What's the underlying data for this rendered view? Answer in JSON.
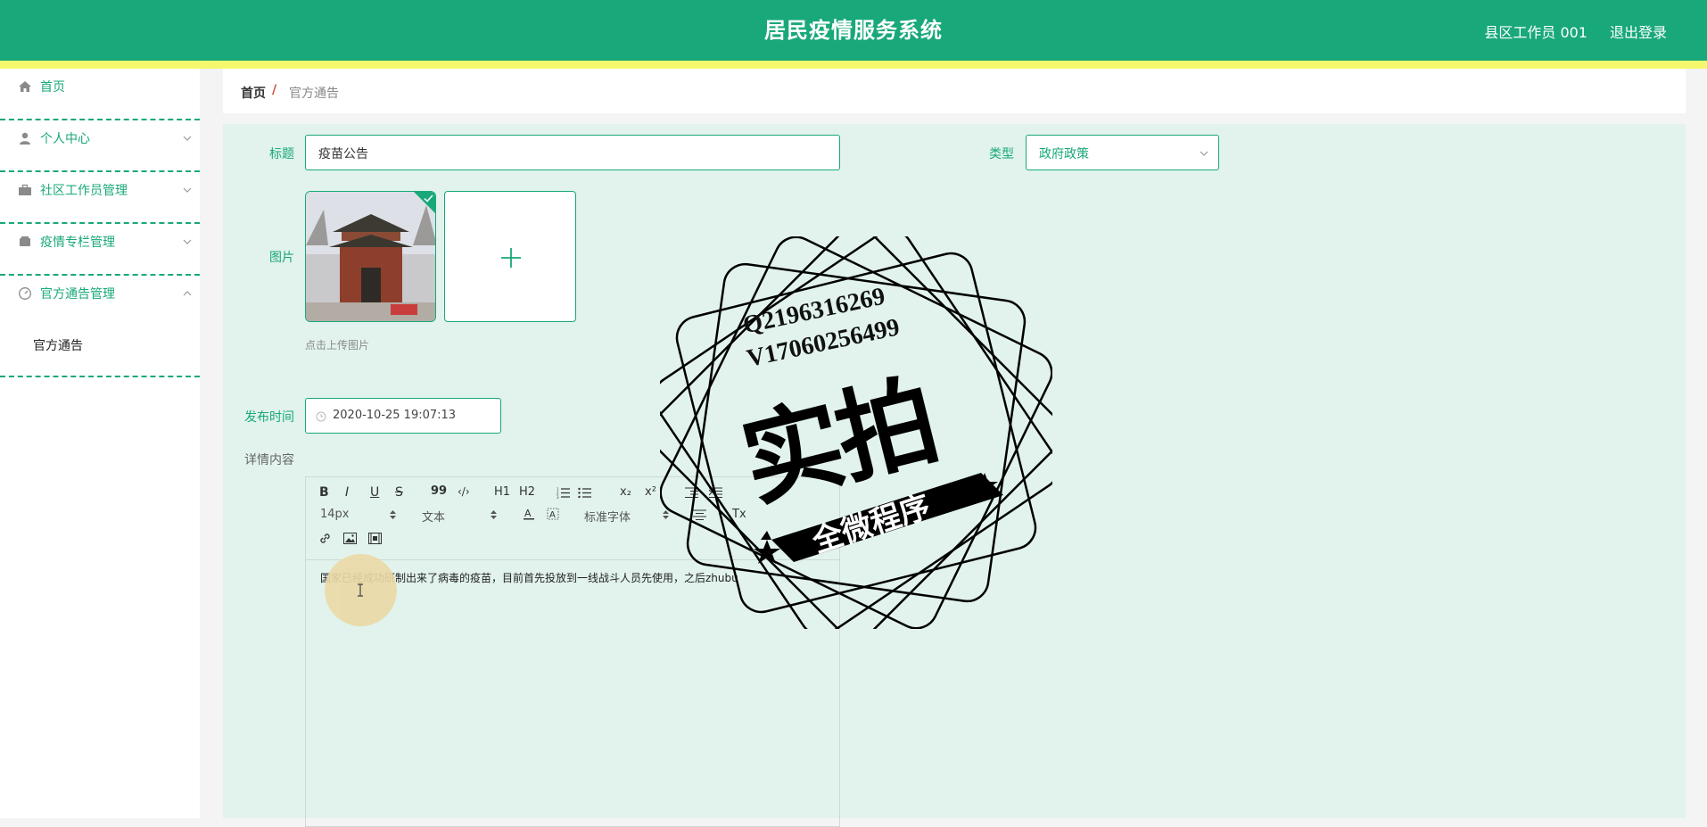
{
  "header": {
    "title": "居民疫情服务系统",
    "user": "县区工作员 001",
    "logout": "退出登录"
  },
  "sidebar": {
    "items": [
      {
        "label": "首页",
        "icon": "home-icon",
        "expandable": false
      },
      {
        "label": "个人中心",
        "icon": "user-icon",
        "expandable": true
      },
      {
        "label": "社区工作员管理",
        "icon": "briefcase-icon",
        "expandable": true
      },
      {
        "label": "疫情专栏管理",
        "icon": "folder-icon",
        "expandable": true
      },
      {
        "label": "官方通告管理",
        "icon": "dashboard-icon",
        "expandable": true,
        "expanded": true
      }
    ],
    "submenu": {
      "label": "官方通告"
    }
  },
  "breadcrumb": {
    "home": "首页",
    "separator": "/",
    "current": "官方通告"
  },
  "form": {
    "title_label": "标题",
    "title_value": "疫苗公告",
    "type_label": "类型",
    "type_value": "政府政策",
    "image_label": "图片",
    "upload_hint": "点击上传图片",
    "time_label": "发布时间",
    "time_value": "2020-10-25 19:07:13",
    "content_label": "详情内容"
  },
  "editor": {
    "toolbar": {
      "bold": "B",
      "italic": "I",
      "underline": "U",
      "strike": "S",
      "quote": "99",
      "code": "‹/›",
      "h1": "H1",
      "h2": "H2",
      "subscript": "x₂",
      "superscript": "x²",
      "font_size": "14px",
      "text_style": "文本",
      "font_family": "标准字体",
      "clear": "Tx"
    },
    "content": "国家已经成功研制出来了病毒的疫苗，目前首先投放到一线战斗人员先使用，之后zhubu"
  },
  "watermark": {
    "line1": "Q2196316269",
    "line2": "V17060256499",
    "main": "实拍",
    "banner": "全微程序"
  },
  "colors": {
    "primary": "#19a87a",
    "accent": "#f5f86d",
    "form_bg": "#e1f3ec"
  }
}
